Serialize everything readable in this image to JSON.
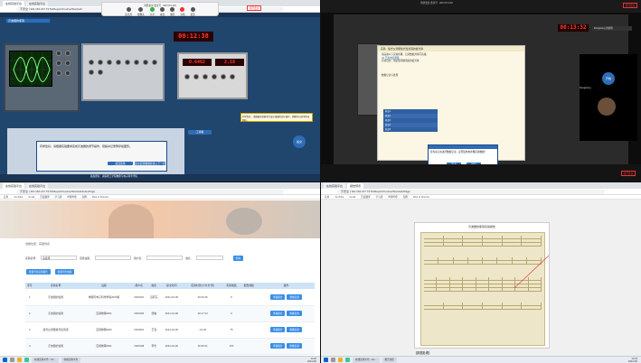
{
  "q1": {
    "tabs": [
      "在线实验平台",
      "在线实验平台"
    ],
    "address": "不安全 | 116.164.217.73:51/Report/Course/StartLab",
    "meeting": {
      "title": "鸿鹄会议 会议号 · 000 074 210",
      "buttons": [
        "麦克风",
        "摄像头",
        "共享",
        "成员",
        "聊天",
        "录制",
        "更多"
      ],
      "end": "离开会议"
    },
    "sim_title": "示波器的使用",
    "lcd_time": "00:12:38",
    "lcd_values": [
      "0.6462",
      "2.18"
    ],
    "dialog_text": "同学您好，请根据实验要求完成示波器的调节操作，观察并记录李萨如图形。",
    "dialog_buttons": [
      "返回实验",
      "提交实验数据并进入下一步"
    ],
    "footer": "版权所有：湖南理工学院物理与电子科学学院",
    "round_btn": "提交",
    "corner_label": "工具箱"
  },
  "q2": {
    "meeting_title": "鸿鹄会议 会议号 · 000 074 210",
    "end": "离开会议",
    "lcd_time": "00:13:32",
    "user_badge": "DongHong 的屏幕",
    "panel_title": "实验 · 旋光仪测量旋光性溶液的旋光率",
    "panel_lines": [
      "请完成以下实验步骤，记录数据并填写表格。",
      "(1) 已知浓度测量",
      "实验目的：测定葡萄糖溶液的旋光率",
      "数据记录与处理"
    ],
    "table_rows": [
      "样品1",
      "样品2",
      "样品3",
      "样品4",
      "样品5"
    ],
    "mini_dialog": "您当前正在进行数据记录，是否提交本步骤实验数据？",
    "mini_buttons": [
      "取消",
      "确定"
    ],
    "round_btn": "开始",
    "participant": "DongHong",
    "end2": "离开会议"
  },
  "q3": {
    "tabs": [
      "在线实验平台",
      "在线实验平台"
    ],
    "address": "不安全 | 116.164.217.73:51/Report/Course/StartLabIndexPage",
    "bookmarks": [
      "应用",
      "YouTube",
      "Gmail",
      "百度翻译",
      "学习通",
      "哔哩哔哩",
      "知网",
      "Web of Science"
    ],
    "breadcrumb": "当前位置：实验列表",
    "filters": {
      "name_label": "实验名称：",
      "name_value": "请选择",
      "class_label": "实验班级：",
      "user_label": "用户名：",
      "name2_label": "姓名：",
      "search": "查询"
    },
    "toolbar_buttons": [
      "批量导出实验报告",
      "批量导出成绩"
    ],
    "columns": [
      "序号",
      "实验名称",
      "班级",
      "用户名",
      "姓名",
      "提交时间",
      "实验时长(小时:分:秒)",
      "实验成绩",
      "报告成绩",
      "操作"
    ],
    "rows": [
      {
        "idx": "1",
        "exp": "示波器的使用",
        "cls": "物理与电子科学学院2020级",
        "user": "2020101",
        "name": "吕晓东",
        "time": "2021-04-06",
        "dur": "00:32:46",
        "score": "9",
        "report": "",
        "ops": [
          "查看报告",
          "重做实验"
        ]
      },
      {
        "idx": "2",
        "exp": "示波器的使用",
        "cls": "应用物理2001",
        "user": "2020106",
        "name": "张敏",
        "time": "2021-04-06",
        "dur": "00:17:13",
        "score": "0",
        "report": "",
        "ops": [
          "查看报告",
          "重做实验"
        ]
      },
      {
        "idx": "3",
        "exp": "旋光仪测量旋光性溶液",
        "cls": "应用物理2002",
        "user": "2020201",
        "name": "王强",
        "time": "2021-04-06",
        "dur": "1:0:29",
        "score": "75",
        "report": "",
        "ops": [
          "查看报告",
          "重做实验"
        ]
      },
      {
        "idx": "4",
        "exp": "示波器的使用",
        "cls": "应用物理2001",
        "user": "2020108",
        "name": "李雪",
        "time": "2021-04-06",
        "dur": "00:25:31",
        "score": "100",
        "report": "",
        "ops": [
          "查看报告",
          "重做实验"
        ]
      }
    ],
    "taskbar": [
      "在线实验平台 - Go...",
      "在线实验平台"
    ],
    "clock": [
      "14:22",
      "2021/4/6"
    ]
  },
  "q4": {
    "tabs": [
      "在线实验平台",
      "报告预览"
    ],
    "address": "不安全 | 116.164.217.73:51/Report/Course/StartLab/Page",
    "bookmarks": [
      "应用",
      "YouTube",
      "Gmail",
      "百度翻译",
      "学习通",
      "哔哩哔哩",
      "知网",
      "Web of Science"
    ],
    "doc_title": "示波器的使用实验报告",
    "section_heading": "【数据处理】",
    "taskbar": [
      "在线实验平台 - Go...",
      "报告预览"
    ],
    "clock": [
      "14:23",
      "2021/4/6"
    ]
  }
}
